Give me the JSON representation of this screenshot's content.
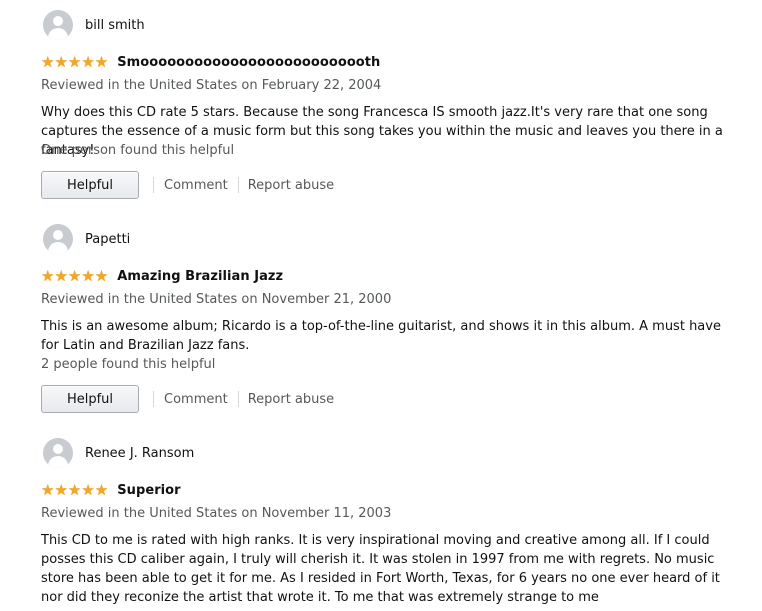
{
  "reviews": [
    {
      "author": "bill smith",
      "stars": "★★★★★",
      "title": "Smoooooooooooooooooooooooooth",
      "meta": "Reviewed in the United States on February 22, 2004",
      "body": "Why does this CD rate 5 stars. Because the song Francesca IS smooth jazz.It's very rare that one song captures the essence of a music form but this song takes you within the music and leaves you there in a fantasy!",
      "helpful_count": "One person found this helpful",
      "helpful_label": "Helpful",
      "comment_label": "Comment",
      "report_label": "Report abuse"
    },
    {
      "author": "Papetti",
      "stars": "★★★★★",
      "title": "Amazing Brazilian Jazz",
      "meta": "Reviewed in the United States on November 21, 2000",
      "body": "This is an awesome album; Ricardo is a top-of-the-line guitarist, and shows it in this album. A must have for Latin and Brazilian Jazz fans.",
      "helpful_count": "2 people found this helpful",
      "helpful_label": "Helpful",
      "comment_label": "Comment",
      "report_label": "Report abuse"
    },
    {
      "author": "Renee J. Ransom",
      "stars": "★★★★★",
      "title": "Superior",
      "meta": "Reviewed in the United States on November 11, 2003",
      "body": "This CD to me is rated with high ranks. It is very inspirational moving and creative among all. If I could posses this CD caliber again, I truly will cherish it. It was stolen in 1997 from me with regrets. No music store has been able to get it for me. As I resided in Fort Worth, Texas, for 6 years no one ever heard of it nor did they reconize the artist that wrote it. To me that was extremely strange to me"
    }
  ],
  "colors": {
    "star": "#f5a623",
    "meta_text": "#565959",
    "body_text": "#111111"
  },
  "icons": {
    "avatar": "user-avatar-icon",
    "star": "star-icon"
  }
}
